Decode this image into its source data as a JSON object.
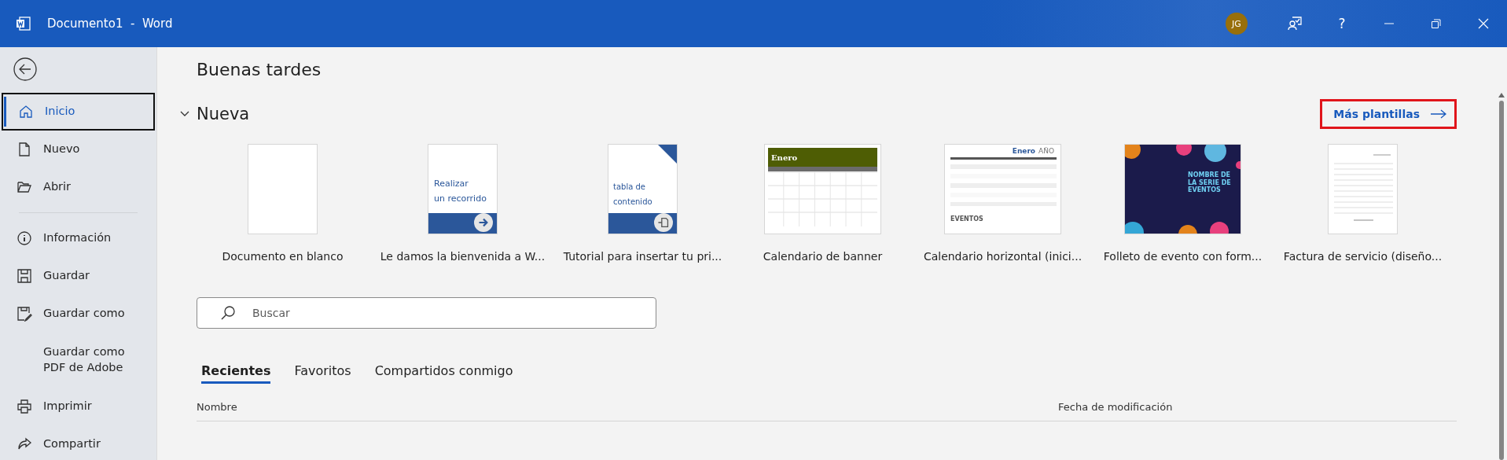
{
  "window": {
    "title": "Documento1  -  Word",
    "user_initials": "JG",
    "help": "?"
  },
  "sidebar": {
    "items": [
      {
        "label": "Inicio",
        "selected": true
      },
      {
        "label": "Nuevo",
        "selected": false
      },
      {
        "label": "Abrir",
        "selected": false
      },
      {
        "kind": "divider"
      },
      {
        "label": "Información",
        "selected": false
      },
      {
        "label": "Guardar",
        "selected": false
      },
      {
        "label": "Guardar como",
        "selected": false
      },
      {
        "label": "Guardar como PDF de Adobe",
        "selected": false
      },
      {
        "label": "Imprimir",
        "selected": false
      },
      {
        "label": "Compartir",
        "selected": false
      }
    ]
  },
  "greeting": "Buenas tardes",
  "new_section": {
    "title": "Nueva",
    "expanded": true,
    "more_link": "Más plantillas",
    "templates": [
      {
        "kind": "blank",
        "label": "Documento en blanco"
      },
      {
        "kind": "tour",
        "label": "Le damos la bienvenida a W...",
        "thumb_lines": [
          "Realizar",
          "un recorrido"
        ]
      },
      {
        "kind": "toc",
        "label": "Tutorial para insertar tu pri...",
        "thumb_lines": [
          "tabla de",
          "contenido"
        ]
      },
      {
        "kind": "banner-calendar",
        "label": "Calendario de banner",
        "thumb_title": "Enero"
      },
      {
        "kind": "horizontal-calendar",
        "label": "Calendario horizontal (inici...",
        "thumb_title": "Enero",
        "thumb_year": "AÑO",
        "thumb_footer": "EVENTOS"
      },
      {
        "kind": "brochure",
        "label": "Folleto de evento con form...",
        "thumb_lines": [
          "NOMBRE DE",
          "LA SERIE DE",
          "EVENTOS"
        ]
      },
      {
        "kind": "invoice",
        "label": "Factura de servicio (diseño..."
      }
    ]
  },
  "search": {
    "placeholder": "Buscar"
  },
  "tabs": [
    {
      "label": "Recientes",
      "selected": true
    },
    {
      "label": "Favoritos",
      "selected": false
    },
    {
      "label": "Compartidos conmigo",
      "selected": false
    }
  ],
  "table": {
    "columns": [
      "Nombre",
      "Fecha de modificación"
    ]
  }
}
